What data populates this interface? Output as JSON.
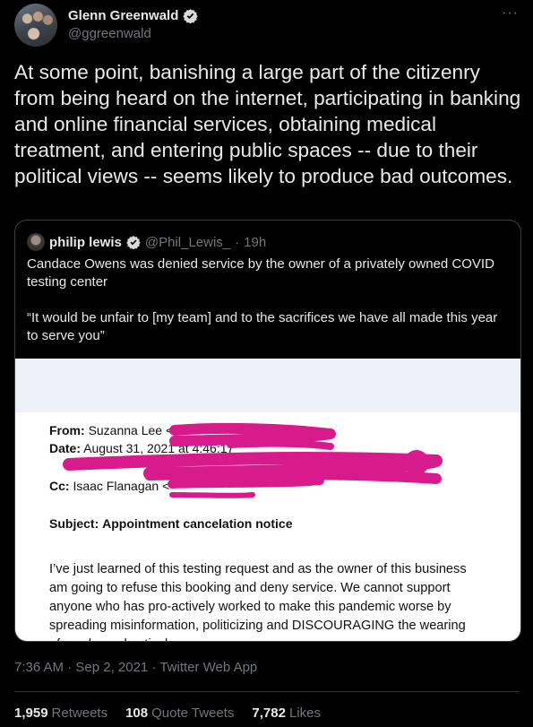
{
  "tweet": {
    "author_name": "Glenn Greenwald",
    "author_handle": "@ggreenwald",
    "more_icon": "more-horizontal-icon",
    "text": "At some point, banishing a large part of the citizenry from being heard on the internet, participating in banking and online financial services, obtaining medical treatment, and entering public spaces -- due to their political views -- seems likely to produce bad outcomes.",
    "timestamp": "7:36 AM · Sep 2, 2021 · Twitter Web App"
  },
  "quote": {
    "author_name": "philip lewis",
    "author_handle": "@Phil_Lewis_",
    "separator": "·",
    "age": "19h",
    "text_1": "Candace Owens was denied service by the owner of a privately owned COVID testing center",
    "text_2": "“It would be unfair to [my team] and to the sacrifices we have all made this year to serve you”"
  },
  "email_image": {
    "from_label": "From:",
    "from_value": "Suzanna Lee <",
    "date_label": "Date:",
    "date_value": "August 31, 2021 at 4:46:17",
    "cc_label": "Cc:",
    "cc_value": "Isaac Flanagan <",
    "subject_label": "Subject:",
    "subject_value": "Appointment cancelation notice",
    "body": "I’ve just learned of this testing request and as the owner of this business am going to refuse this booking and deny service. We cannot support anyone who has pro-actively worked to make this pandemic worse by spreading misinformation, politicizing and DISCOURAGING the wearing of masks and actively",
    "redaction_color": "#d81b8c"
  },
  "stats": [
    {
      "count": "1,959",
      "label": "Retweets"
    },
    {
      "count": "108",
      "label": "Quote Tweets"
    },
    {
      "count": "7,782",
      "label": "Likes"
    }
  ],
  "colors": {
    "background": "#000000",
    "verified": "#d9d9d9",
    "muted": "#71767b"
  }
}
